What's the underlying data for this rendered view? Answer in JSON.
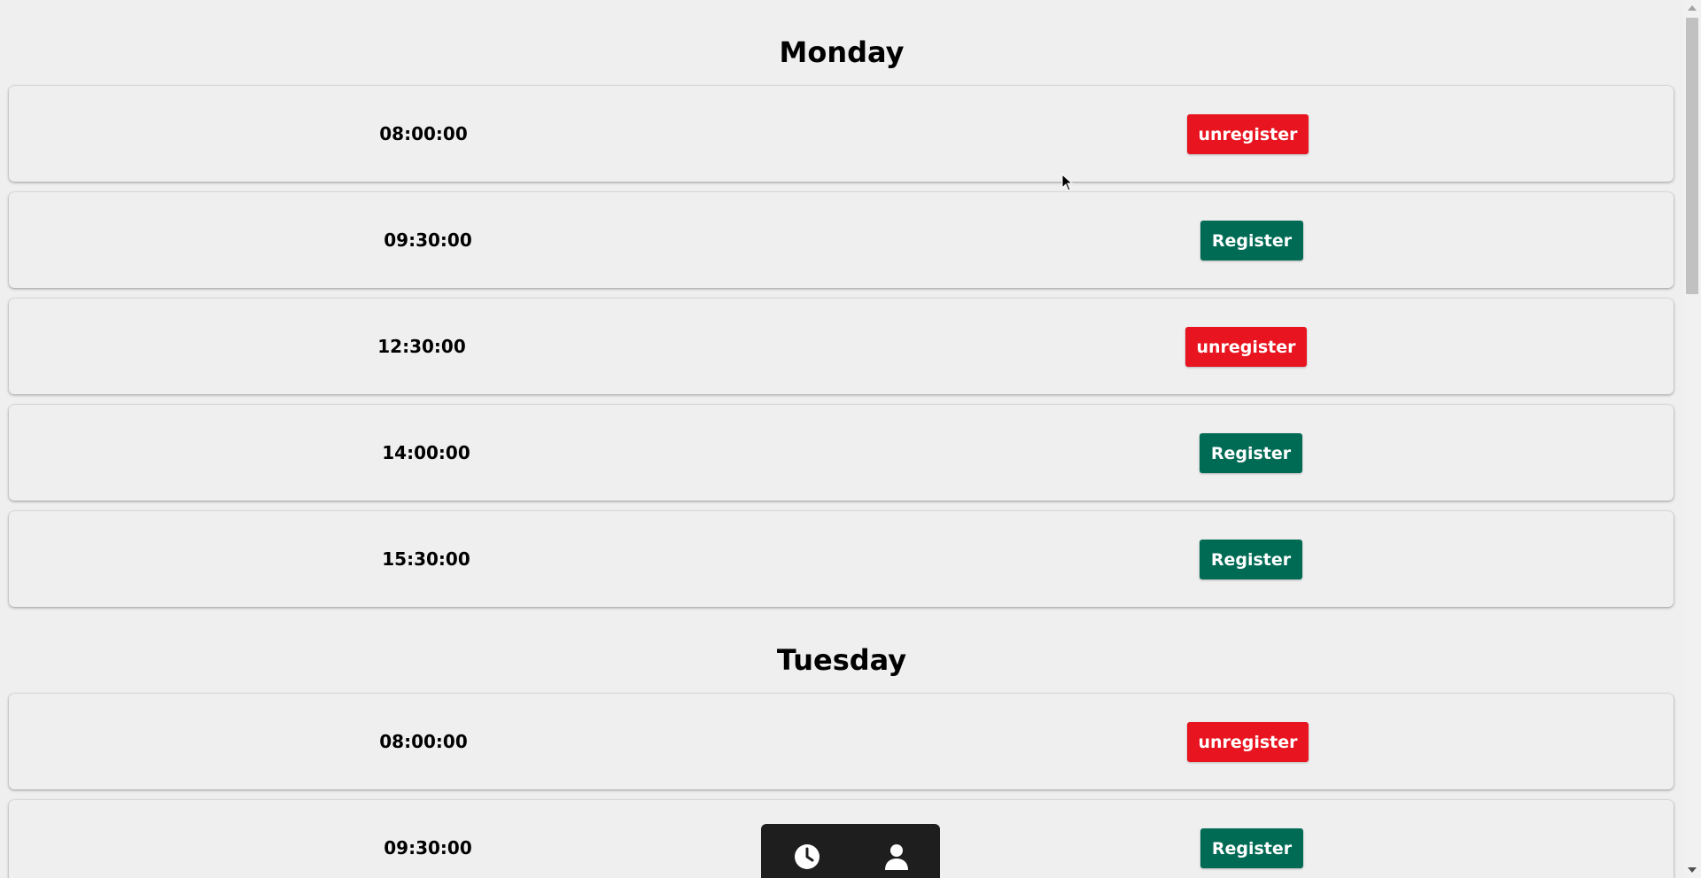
{
  "schedule": {
    "days": [
      {
        "name": "Monday",
        "slots": [
          {
            "time": "08:00:00",
            "action": "unregister"
          },
          {
            "time": "09:30:00",
            "action": "Register"
          },
          {
            "time": "12:30:00",
            "action": "unregister"
          },
          {
            "time": "14:00:00",
            "action": "Register"
          },
          {
            "time": "15:30:00",
            "action": "Register"
          }
        ]
      },
      {
        "name": "Tuesday",
        "slots": [
          {
            "time": "08:00:00",
            "action": "unregister"
          },
          {
            "time": "09:30:00",
            "action": "Register"
          }
        ]
      }
    ]
  },
  "bottom_nav": {
    "items": [
      {
        "icon": "clock-icon"
      },
      {
        "icon": "user-icon"
      }
    ]
  },
  "colors": {
    "background": "#efefef",
    "unregister": "#e8141f",
    "register": "#006b55",
    "nav": "#1e1e1e"
  }
}
